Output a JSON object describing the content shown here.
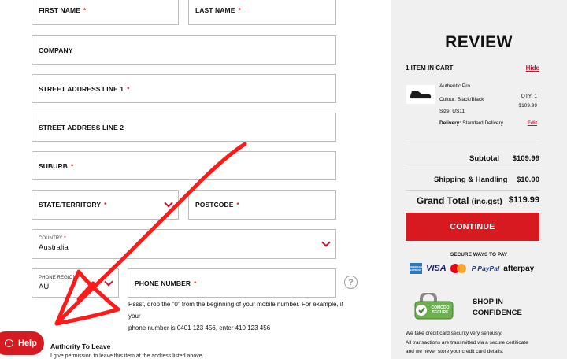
{
  "form": {
    "first_name": "FIRST NAME",
    "last_name": "LAST NAME",
    "company": "COMPANY",
    "street1": "STREET ADDRESS LINE 1",
    "street2": "STREET ADDRESS LINE 2",
    "suburb": "SUBURB",
    "state": "STATE/TERRITORY",
    "postcode": "POSTCODE",
    "country_label": "COUNTRY",
    "country_value": "Australia",
    "phone_region_label": "PHONE REGION",
    "phone_region_value": "AU",
    "phone_number": "PHONE NUMBER",
    "required_mark": "*",
    "help_icon": "?",
    "hint_line1": "Pssst, drop the \"0\" from the beginning of your mobile number. For example, if your",
    "hint_line2": "phone number is 0401 123 456, enter 410 123 456",
    "authority_title": "Authority To Leave",
    "authority_text": "I give permission to leave this item at the address listed above."
  },
  "help_button": {
    "label": "Help"
  },
  "review": {
    "title": "REVIEW",
    "items_count": "1 ITEM IN CART",
    "hide": "Hide",
    "product": {
      "name": "Authentic Pro",
      "colour": "Colour:   Black/Black",
      "size": "Size:   US11",
      "qty": "QTY: 1",
      "price": "$109.99",
      "delivery_label": "Delivery:",
      "delivery_value": "Standard Delivery",
      "edit": "Edit"
    },
    "subtotal_label": "Subtotal",
    "subtotal_value": "$109.99",
    "shipping_label": "Shipping & Handling",
    "shipping_value": "$10.00",
    "grand_label": "Grand Total",
    "grand_suffix": "(inc.gst)",
    "grand_value": "$119.99",
    "continue": "CONTINUE",
    "secure_ways": "SECURE WAYS TO PAY",
    "payment": {
      "amex": "AMERICAN EXPRESS",
      "visa": "VISA",
      "paypal": "P PayPal",
      "afterpay": "afterpay"
    },
    "comodo": "COMODO SECURE",
    "shop_line1": "SHOP IN",
    "shop_line2": "CONFIDENCE",
    "secure_line1": "We take credit card security very seriously.",
    "secure_line2": "All transactions are transmitted via a secure certificate",
    "secure_line3": "and we never store your credit card details."
  },
  "colors": {
    "accent": "#d71920",
    "panel_bg": "#f0f0f0",
    "annotation": "#ff1a1a"
  }
}
